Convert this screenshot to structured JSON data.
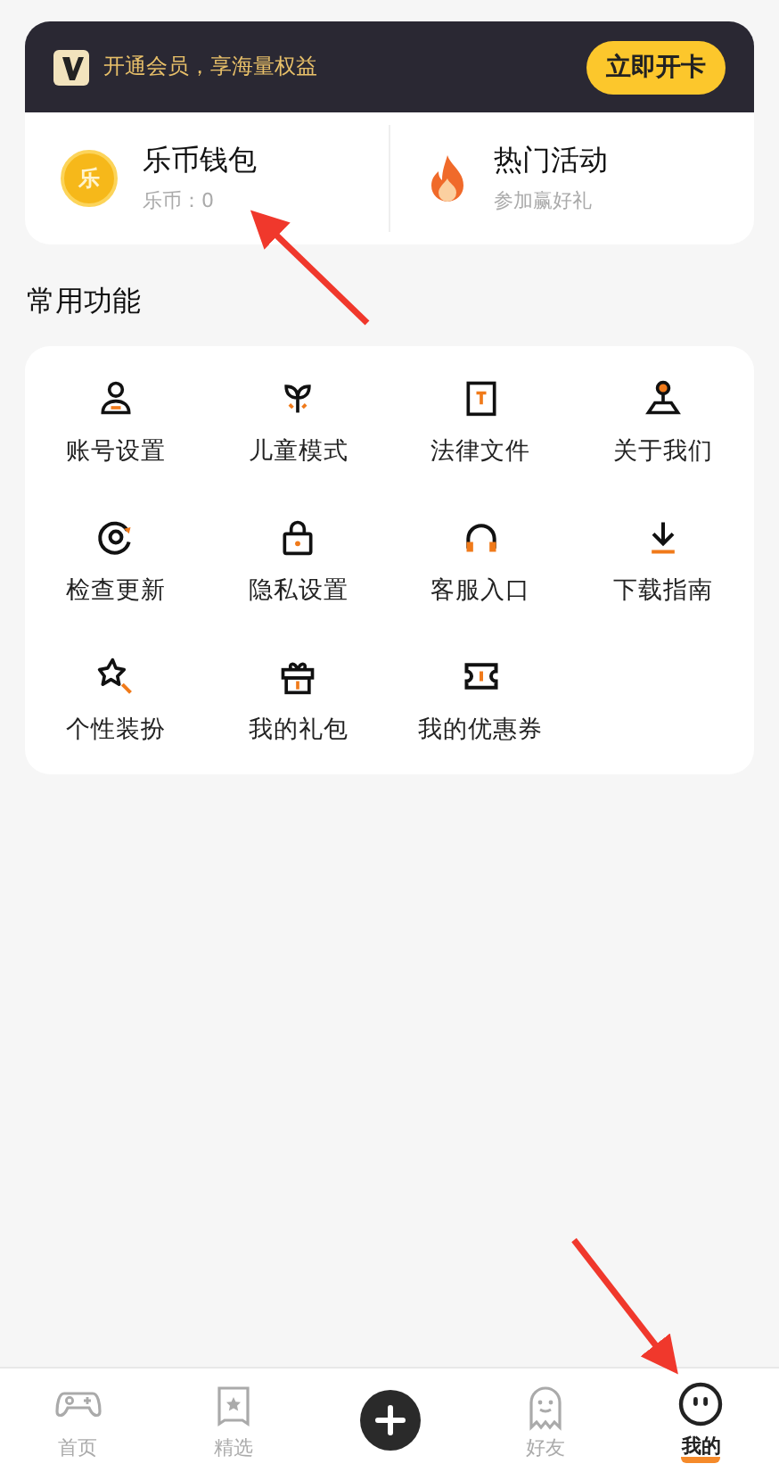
{
  "vip_banner": {
    "text": "开通会员，享海量权益",
    "button": "立即开卡"
  },
  "shortcuts": [
    {
      "title": "乐币钱包",
      "subtitle": "乐币：0",
      "coin_label": "乐"
    },
    {
      "title": "热门活动",
      "subtitle": "参加赢好礼"
    }
  ],
  "section_title": "常用功能",
  "functions": [
    {
      "label": "账号设置"
    },
    {
      "label": "儿童模式"
    },
    {
      "label": "法律文件"
    },
    {
      "label": "关于我们"
    },
    {
      "label": "检查更新"
    },
    {
      "label": "隐私设置"
    },
    {
      "label": "客服入口"
    },
    {
      "label": "下载指南"
    },
    {
      "label": "个性装扮"
    },
    {
      "label": "我的礼包"
    },
    {
      "label": "我的优惠券"
    }
  ],
  "tab_bar": [
    {
      "kind": "tab",
      "label": "首页",
      "selected": false
    },
    {
      "kind": "tab",
      "label": "精选",
      "selected": false
    },
    {
      "kind": "add",
      "selected": false
    },
    {
      "kind": "tab",
      "label": "好友",
      "selected": false
    },
    {
      "kind": "tab",
      "label": "我的",
      "selected": true
    }
  ]
}
